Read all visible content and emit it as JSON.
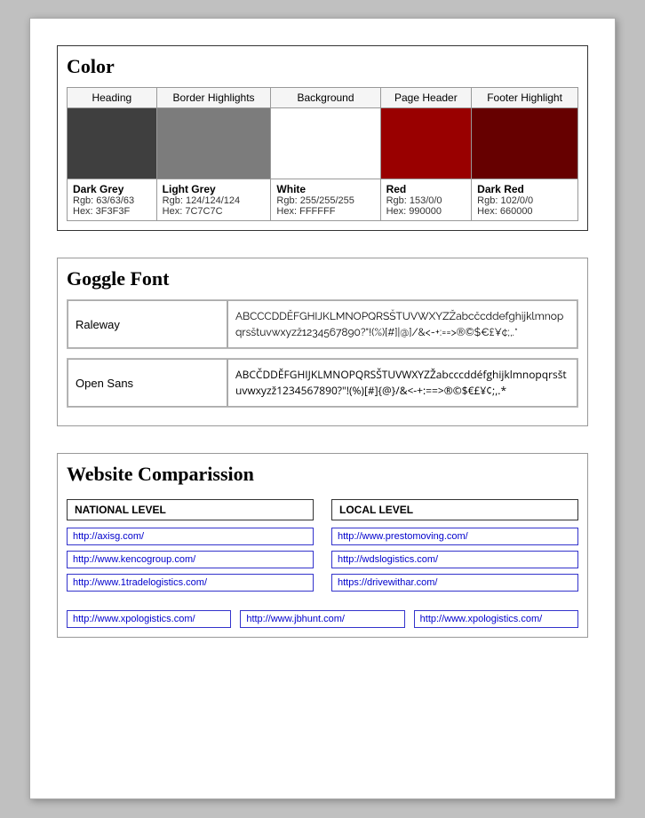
{
  "color_section": {
    "title": "Color",
    "columns": [
      "Heading",
      "Border Highlights",
      "Background",
      "Page Header",
      "Footer Highlight"
    ],
    "swatches": [
      {
        "class": "swatch-dark-grey",
        "name": "Dark Grey",
        "rgb": "Rgb: 63/63/63",
        "hex": "Hex: 3F3F3F"
      },
      {
        "class": "swatch-light-grey",
        "name": "Light Grey",
        "rgb": "Rgb: 124/124/124",
        "hex": "Hex: 7C7C7C"
      },
      {
        "class": "swatch-white",
        "name": "White",
        "rgb": "Rgb: 255/255/255",
        "hex": "Hex: FFFFFF"
      },
      {
        "class": "swatch-red",
        "name": "Red",
        "rgb": "Rgb: 153/0/0",
        "hex": "Hex: 990000"
      },
      {
        "class": "swatch-dark-red",
        "name": "Dark Red",
        "rgb": "Rgb: 102/0/0",
        "hex": "Hex: 660000"
      }
    ]
  },
  "font_section": {
    "title": "Goggle Font",
    "fonts": [
      {
        "label": "Raleway",
        "sample": "ABCCCDDĚFGHIJKLMNOPQRSŠTUVWXYZŽabcčcddefghijklmnopqrsštuvwxyzž1234567890?\"!(%)​[#]|@]/&<-+:==>®©$€£¥¢;,.*"
      },
      {
        "label": "Open Sans",
        "sample": "ABCČDDĚFGHIJKLMNOPQRSŠTUVWXYZŽabcccddéfghijklmnopqrsštuvwxyzž1234567890?\"!(%)​[#]{@}/&<-+:==>®©$€£¥¢;,.*"
      }
    ]
  },
  "website_section": {
    "title": "Website Comparission",
    "national": {
      "header": "NATIONAL LEVEL",
      "urls": [
        "http://axisg.com/",
        "http://www.kencogroup.com/",
        "http://www.1tradelogistics.com/"
      ]
    },
    "local": {
      "header": "LOCAL LEVEL",
      "urls": [
        "http://www.prestomoving.com/",
        "http://wdslogistics.com/",
        "https://drivewithar.com/"
      ]
    },
    "bottom_urls": [
      "http://www.xpologistics.com/",
      "http://www.jbhunt.com/",
      "http://www.xpologistics.com/"
    ]
  }
}
